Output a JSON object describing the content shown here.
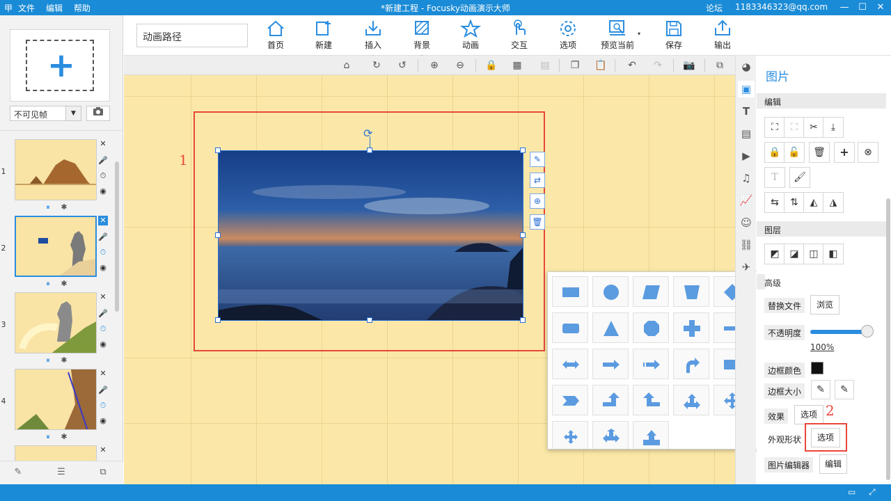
{
  "app": {
    "logo_text": "甲",
    "title": "*新建工程 - Focusky动画演示大师",
    "menu": [
      "文件",
      "编辑",
      "帮助"
    ],
    "forum": "论坛",
    "account": "1183346323@qq.com",
    "window_controls": [
      "minimize-icon",
      "restore-icon",
      "close-icon"
    ]
  },
  "left_panel": {
    "frame_select_value": "不可见帧",
    "slides": [
      {
        "num": "1"
      },
      {
        "num": "2"
      },
      {
        "num": "3"
      },
      {
        "num": "4"
      },
      {
        "num": ""
      }
    ]
  },
  "toolbar": {
    "path_input_value": "动画路径",
    "buttons": [
      {
        "label": "首页",
        "icon": "home-icon"
      },
      {
        "label": "新建",
        "icon": "new-icon"
      },
      {
        "label": "插入",
        "icon": "insert-icon"
      },
      {
        "label": "背景",
        "icon": "background-icon"
      },
      {
        "label": "动画",
        "icon": "animation-icon"
      },
      {
        "label": "交互",
        "icon": "interact-icon"
      },
      {
        "label": "选项",
        "icon": "options-icon"
      },
      {
        "label": "预览当前",
        "icon": "preview-icon"
      },
      {
        "label": "保存",
        "icon": "save-icon"
      },
      {
        "label": "输出",
        "icon": "export-icon"
      }
    ]
  },
  "canvas": {
    "annotation_1": "1",
    "annotation_2": "2"
  },
  "right_panel": {
    "title": "图片",
    "sections": {
      "edit": "编辑",
      "layer": "图层",
      "advanced": "高级"
    },
    "replace_file_label": "替换文件",
    "browse_button": "浏览",
    "opacity_label": "不透明度",
    "opacity_value": "100%",
    "opacity_fraction": 1.0,
    "border_color_label": "边框颜色",
    "border_size_label": "边框大小",
    "effect_label": "效果",
    "effect_button": "选项",
    "shape_label": "外观形状",
    "shape_button": "选项",
    "image_editor_label": "图片编辑器",
    "image_editor_button": "编辑"
  },
  "colors": {
    "accent": "#2a8de0",
    "titlebar": "#1a8bd6",
    "canvas_bg": "#fbe8a8",
    "highlight_red": "#e8463a",
    "shape_fill": "#5b9be0"
  }
}
